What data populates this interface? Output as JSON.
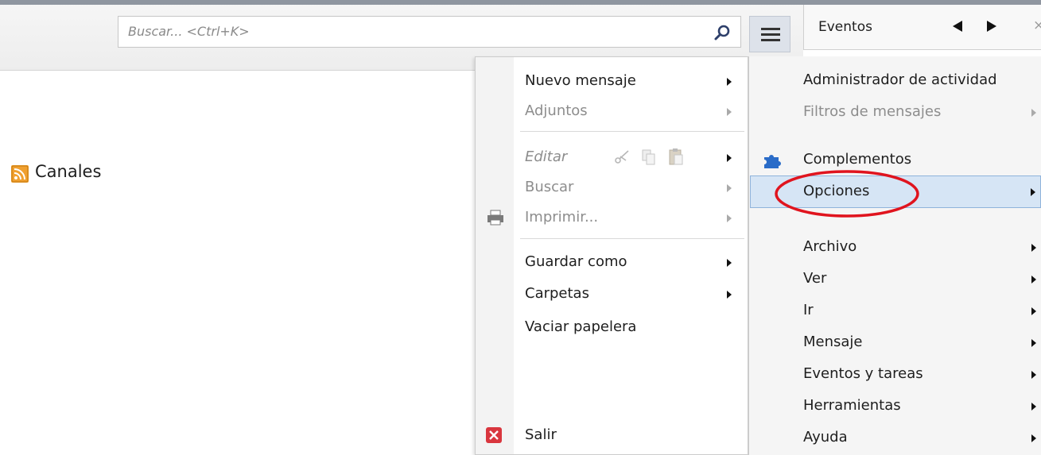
{
  "search": {
    "placeholder": "Buscar... <Ctrl+K>"
  },
  "events_panel": {
    "title": "Eventos",
    "close_glyph": "×"
  },
  "folder_tree": {
    "feed_label": "Canales"
  },
  "submenu": {
    "items": [
      {
        "label": "Nuevo mensaje",
        "enabled": true,
        "has_submenu": true
      },
      {
        "label": "Adjuntos",
        "enabled": false,
        "has_submenu": true
      },
      {
        "label": "Editar",
        "enabled": false,
        "has_submenu": true
      },
      {
        "label": "Buscar",
        "enabled": false,
        "has_submenu": true
      },
      {
        "label": "Imprimir...",
        "enabled": false,
        "has_submenu": true
      },
      {
        "label": "Guardar como",
        "enabled": true,
        "has_submenu": true
      },
      {
        "label": "Carpetas",
        "enabled": true,
        "has_submenu": true
      },
      {
        "label": "Vaciar papelera",
        "enabled": true,
        "has_submenu": false
      },
      {
        "label": "Salir",
        "enabled": true,
        "has_submenu": false
      }
    ]
  },
  "main_menu": {
    "items": [
      {
        "label": "Administrador de actividad",
        "enabled": true,
        "has_submenu": false
      },
      {
        "label": "Filtros de mensajes",
        "enabled": false,
        "has_submenu": true
      },
      {
        "label": "Complementos",
        "enabled": true,
        "has_submenu": false
      },
      {
        "label": "Opciones",
        "enabled": true,
        "has_submenu": true,
        "highlighted": true
      },
      {
        "label": "Archivo",
        "enabled": true,
        "has_submenu": true
      },
      {
        "label": "Ver",
        "enabled": true,
        "has_submenu": true
      },
      {
        "label": "Ir",
        "enabled": true,
        "has_submenu": true
      },
      {
        "label": "Mensaje",
        "enabled": true,
        "has_submenu": true
      },
      {
        "label": "Eventos y tareas",
        "enabled": true,
        "has_submenu": true
      },
      {
        "label": "Herramientas",
        "enabled": true,
        "has_submenu": true
      },
      {
        "label": "Ayuda",
        "enabled": true,
        "has_submenu": true
      }
    ]
  },
  "colors": {
    "highlight": "#d6e5f5",
    "callout": "#e0141e",
    "puzzle_icon": "#2a6cc8",
    "feed_icon": "#f0a030",
    "exit_icon": "#d9363e"
  },
  "icons": {
    "search": "magnifier-icon",
    "app_menu": "hamburger-icon",
    "prev": "triangle-left-icon",
    "next": "triangle-right-icon",
    "feed": "rss-feed-icon",
    "print": "printer-icon",
    "complementos": "puzzle-piece-icon",
    "exit": "close-x-icon",
    "edit_cut": "scissors-icon",
    "edit_copy": "copy-icon",
    "edit_paste": "paste-icon"
  }
}
